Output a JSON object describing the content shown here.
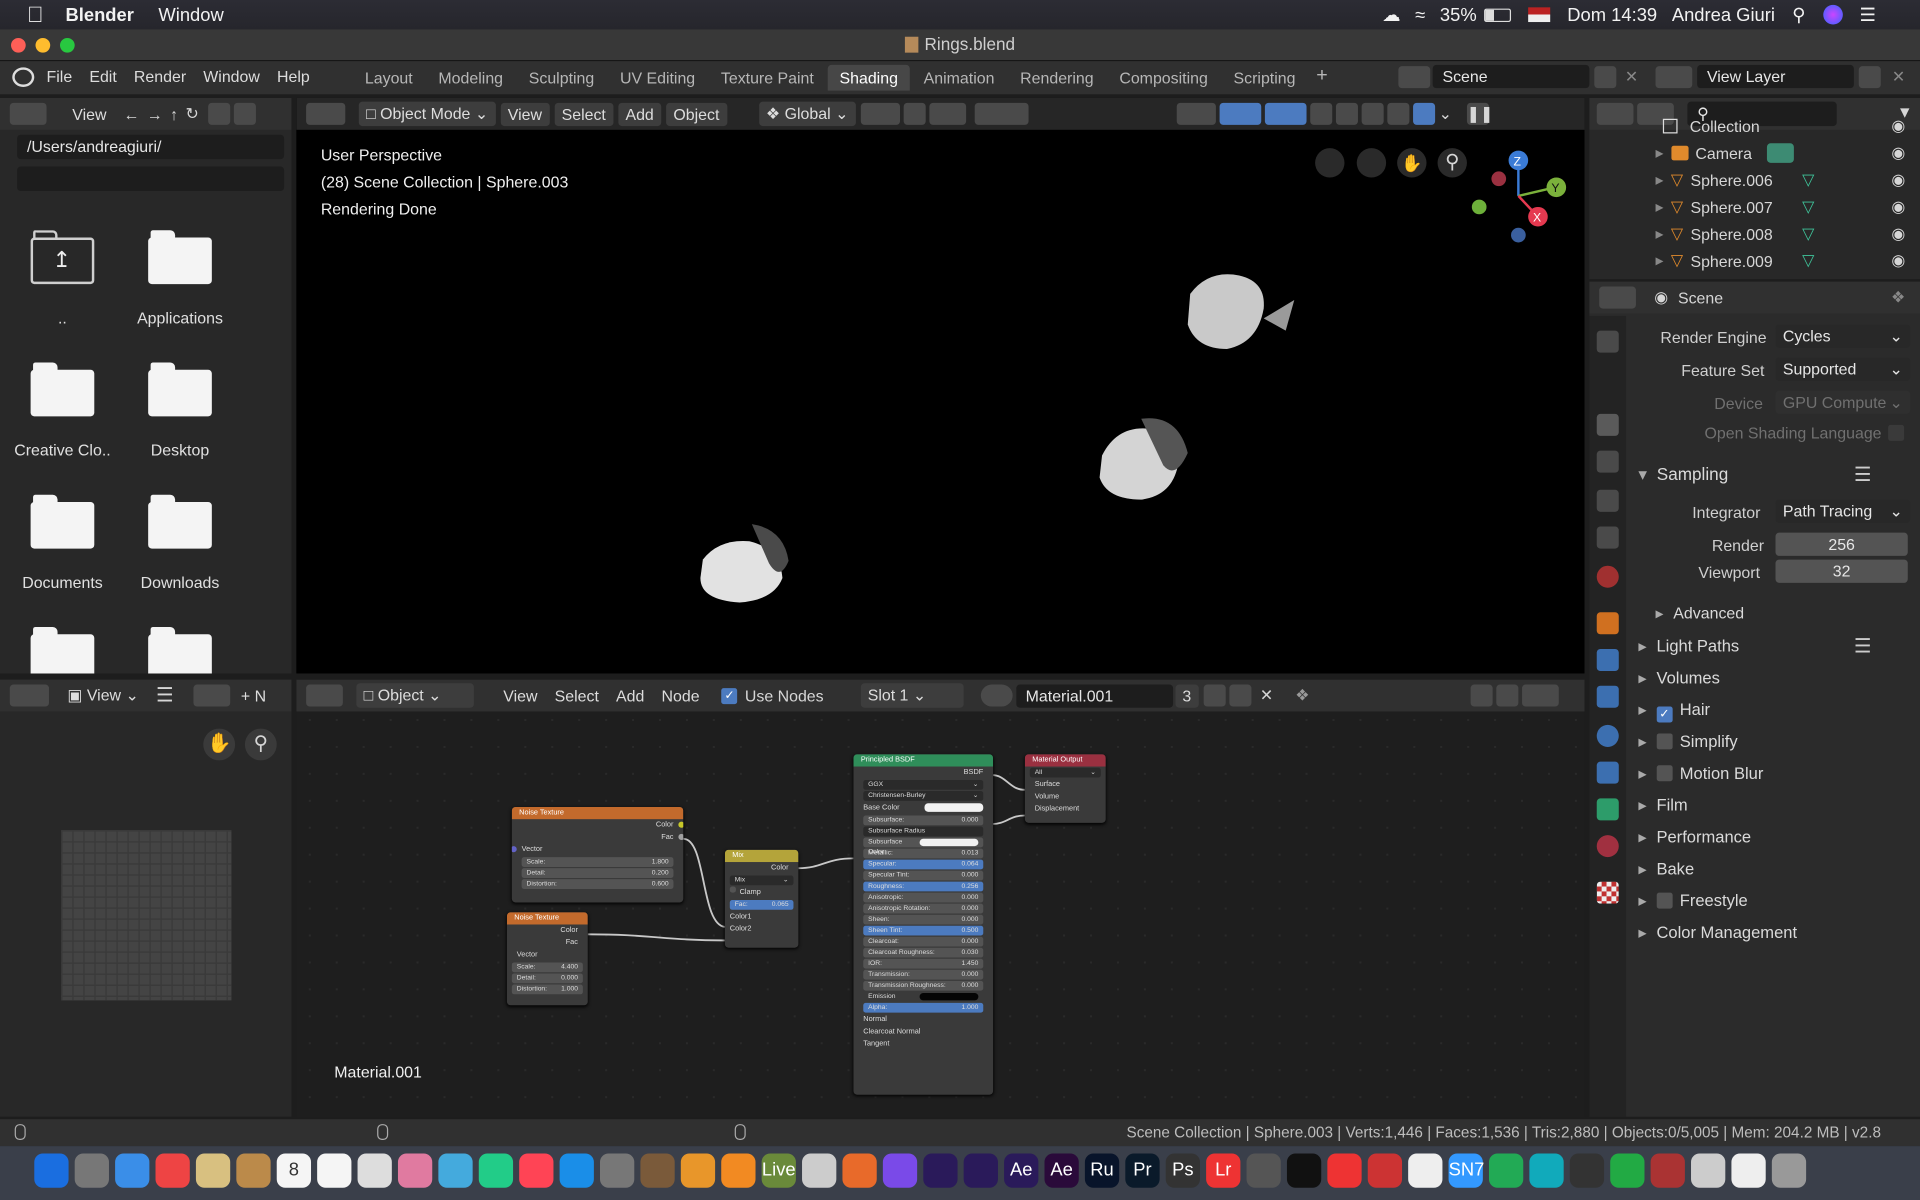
{
  "menubar": {
    "app": "Blender",
    "menu": "Window",
    "battery": "35%",
    "clock": "Dom 14:39",
    "user": "Andrea Giuri"
  },
  "window": {
    "title": "Rings.blend"
  },
  "header": {
    "menus": [
      "File",
      "Edit",
      "Render",
      "Window",
      "Help"
    ],
    "workspaces": [
      "Layout",
      "Modeling",
      "Sculpting",
      "UV Editing",
      "Texture Paint",
      "Shading",
      "Animation",
      "Rendering",
      "Compositing",
      "Scripting"
    ],
    "active_workspace": "Shading",
    "scene": "Scene",
    "view_layer": "View Layer"
  },
  "filebrowser": {
    "view_label": "View",
    "path": "/Users/andreagiuri/",
    "filter": "",
    "items": [
      "..",
      "Applications",
      "Creative Clo..",
      "Desktop",
      "Documents",
      "Downloads",
      "",
      ""
    ]
  },
  "viewport": {
    "mode": "Object Mode",
    "menus": [
      "View",
      "Select",
      "Add",
      "Object"
    ],
    "orientation": "Global",
    "info_lines": [
      "User Perspective",
      "(28) Scene Collection | Sphere.003",
      "Rendering Done"
    ],
    "axes": [
      "Z",
      "Y",
      "X"
    ]
  },
  "outliner": {
    "items": [
      {
        "name": "Collection",
        "icon": "collection-icon"
      },
      {
        "name": "Camera",
        "icon": "camera-icon"
      },
      {
        "name": "Sphere.006",
        "icon": "mesh-icon"
      },
      {
        "name": "Sphere.007",
        "icon": "mesh-icon"
      },
      {
        "name": "Sphere.008",
        "icon": "mesh-icon"
      },
      {
        "name": "Sphere.009",
        "icon": "mesh-icon"
      }
    ]
  },
  "properties": {
    "title": "Scene",
    "render_engine_label": "Render Engine",
    "render_engine": "Cycles",
    "feature_set_label": "Feature Set",
    "feature_set": "Supported",
    "device_label": "Device",
    "device": "GPU Compute",
    "osl_label": "Open Shading Language",
    "sampling": "Sampling",
    "integrator_label": "Integrator",
    "integrator": "Path Tracing",
    "render_label": "Render",
    "render_samples": "256",
    "viewport_label": "Viewport",
    "viewport_samples": "32",
    "advanced": "Advanced",
    "sections": [
      {
        "label": "Light Paths",
        "checkbox": null
      },
      {
        "label": "Volumes",
        "checkbox": null
      },
      {
        "label": "Hair",
        "checkbox": true
      },
      {
        "label": "Simplify",
        "checkbox": false
      },
      {
        "label": "Motion Blur",
        "checkbox": false
      },
      {
        "label": "Film",
        "checkbox": null
      },
      {
        "label": "Performance",
        "checkbox": null
      },
      {
        "label": "Bake",
        "checkbox": null
      },
      {
        "label": "Freestyle",
        "checkbox": false
      },
      {
        "label": "Color Management",
        "checkbox": null
      }
    ]
  },
  "imageeditor": {
    "view_label": "View",
    "new_label": "N"
  },
  "nodeeditor": {
    "object_label": "Object",
    "menus": [
      "View",
      "Select",
      "Add",
      "Node"
    ],
    "use_nodes": "Use Nodes",
    "slot": "Slot 1",
    "material": "Material.001",
    "users": "3",
    "corner_label": "Material.001",
    "nodes": {
      "noise1": {
        "title": "Noise Texture",
        "out": [
          "Color",
          "Fac"
        ],
        "vector": "Vector",
        "fields": [
          [
            "Scale:",
            "1.800"
          ],
          [
            "Detail:",
            "0.200"
          ],
          [
            "Distortion:",
            "0.600"
          ]
        ]
      },
      "noise2": {
        "title": "Noise Texture",
        "out": [
          "Color",
          "Fac"
        ],
        "vector": "Vector",
        "fields": [
          [
            "Scale:",
            "4.400"
          ],
          [
            "Detail:",
            "0.000"
          ],
          [
            "Distortion:",
            "1.000"
          ]
        ]
      },
      "mix": {
        "title": "Mix",
        "out": "Color",
        "blend": "Mix",
        "clamp": "Clamp",
        "fac": [
          "Fac:",
          "0.065"
        ],
        "inputs": [
          "Color1",
          "Color2"
        ]
      },
      "bsdf": {
        "title": "Principled BSDF",
        "out": "BSDF",
        "dist": "GGX",
        "sss": "Christensen-Burley",
        "base_color": "Base Color",
        "rows": [
          [
            "Subsurface:",
            "0.000"
          ],
          [
            "Subsurface Radius",
            ""
          ],
          [
            "Subsurface Color",
            ""
          ],
          [
            "Metallic:",
            "0.013"
          ],
          [
            "Specular:",
            "0.064"
          ],
          [
            "Specular Tint:",
            "0.000"
          ],
          [
            "Roughness:",
            "0.256"
          ],
          [
            "Anisotropic:",
            "0.000"
          ],
          [
            "Anisotropic Rotation:",
            "0.000"
          ],
          [
            "Sheen:",
            "0.000"
          ],
          [
            "Sheen Tint:",
            "0.500"
          ],
          [
            "Clearcoat:",
            "0.000"
          ],
          [
            "Clearcoat Roughness:",
            "0.030"
          ],
          [
            "IOR:",
            "1.450"
          ],
          [
            "Transmission:",
            "0.000"
          ],
          [
            "Transmission Roughness:",
            "0.000"
          ],
          [
            "Emission",
            ""
          ],
          [
            "Alpha:",
            "1.000"
          ]
        ],
        "vectors": [
          "Normal",
          "Clearcoat Normal",
          "Tangent"
        ]
      },
      "output": {
        "title": "Material Output",
        "target": "All",
        "inputs": [
          "Surface",
          "Volume",
          "Displacement"
        ]
      }
    }
  },
  "statusbar": {
    "text": "Scene Collection | Sphere.003 | Verts:1,446 | Faces:1,536 | Tris:2,880 | Objects:0/5,005 | Mem: 204.2 MB | v2.8"
  },
  "dock": {
    "calendar_day": "8",
    "labels": [
      "Ae",
      "Ae",
      "Ru",
      "Pr",
      "Ps",
      "Lr",
      "SN7",
      "Live"
    ]
  }
}
